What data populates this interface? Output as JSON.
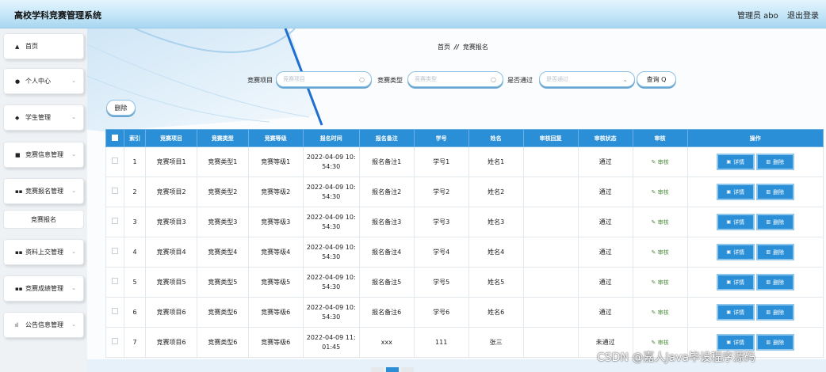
{
  "header": {
    "app_title": "高校学科竞赛管理系统",
    "admin_label": "管理员 abo",
    "logout": "退出登录"
  },
  "sidebar": {
    "items": [
      {
        "icon": "home-icon",
        "glyph": "▲",
        "label": "首页",
        "has_chevron": false
      },
      {
        "icon": "user-icon",
        "glyph": "●",
        "label": "个人中心",
        "has_chevron": true
      },
      {
        "icon": "student-icon",
        "glyph": "◆",
        "label": "学生管理",
        "has_chevron": true
      },
      {
        "icon": "briefcase-icon",
        "glyph": "■",
        "label": "竞赛信息管理",
        "has_chevron": true
      },
      {
        "icon": "grid-icon",
        "glyph": "▪▪",
        "label": "竞赛报名管理",
        "has_chevron": true
      },
      {
        "icon": "grid-icon",
        "glyph": "▪▪",
        "label": "资料上交管理",
        "has_chevron": true
      },
      {
        "icon": "grid-icon",
        "glyph": "▪▪",
        "label": "竞赛成绩管理",
        "has_chevron": true
      },
      {
        "icon": "bar-chart-icon",
        "glyph": "ıl",
        "label": "公告信息管理",
        "has_chevron": true
      }
    ],
    "sub_item": "竞赛报名"
  },
  "breadcrumb": {
    "home": "首页",
    "sep": "//",
    "current": "竞赛报名"
  },
  "search": {
    "project_label": "竞赛项目",
    "project_placeholder": "竞赛项目",
    "type_label": "竞赛类型",
    "type_placeholder": "竞赛类型",
    "pass_label": "是否通过",
    "pass_placeholder": "是否通过",
    "query_button": "查询 Q"
  },
  "toolbar": {
    "delete_batch": "删除"
  },
  "table": {
    "headers": [
      "",
      "索引",
      "竞赛项目",
      "竞赛类型",
      "竞赛等级",
      "报名时间",
      "报名备注",
      "学号",
      "姓名",
      "审核回复",
      "审核状态",
      "审核",
      "操作"
    ],
    "rows": [
      {
        "index": "1",
        "project": "竞赛项目1",
        "type": "竞赛类型1",
        "level": "竞赛等级1",
        "time": "2022-04-09 10:\n54:30",
        "remark": "报名备注1",
        "student_no": "学号1",
        "name": "姓名1",
        "reply": "",
        "status": "通过"
      },
      {
        "index": "2",
        "project": "竞赛项目2",
        "type": "竞赛类型2",
        "level": "竞赛等级2",
        "time": "2022-04-09 10:\n54:30",
        "remark": "报名备注2",
        "student_no": "学号2",
        "name": "姓名2",
        "reply": "",
        "status": "通过"
      },
      {
        "index": "3",
        "project": "竞赛项目3",
        "type": "竞赛类型3",
        "level": "竞赛等级3",
        "time": "2022-04-09 10:\n54:30",
        "remark": "报名备注3",
        "student_no": "学号3",
        "name": "姓名3",
        "reply": "",
        "status": "通过"
      },
      {
        "index": "4",
        "project": "竞赛项目4",
        "type": "竞赛类型4",
        "level": "竞赛等级4",
        "time": "2022-04-09 10:\n54:30",
        "remark": "报名备注4",
        "student_no": "学号4",
        "name": "姓名4",
        "reply": "",
        "status": "通过"
      },
      {
        "index": "5",
        "project": "竞赛项目5",
        "type": "竞赛类型5",
        "level": "竞赛等级5",
        "time": "2022-04-09 10:\n54:30",
        "remark": "报名备注5",
        "student_no": "学号5",
        "name": "姓名5",
        "reply": "",
        "status": "通过"
      },
      {
        "index": "6",
        "project": "竞赛项目6",
        "type": "竞赛类型6",
        "level": "竞赛等级6",
        "time": "2022-04-09 10:\n54:30",
        "remark": "报名备注6",
        "student_no": "学号6",
        "name": "姓名6",
        "reply": "",
        "status": "通过"
      },
      {
        "index": "7",
        "project": "竞赛项目6",
        "type": "竞赛类型6",
        "level": "竞赛等级6",
        "time": "2022-04-09 11:\n01:45",
        "remark": "xxx",
        "student_no": "111",
        "name": "张三",
        "reply": "",
        "status": "未通过"
      }
    ],
    "audit_link": "✎ 审核",
    "detail_button": "详情",
    "delete_button": "删除"
  },
  "watermark": "CSDN @嘉人Java毕设程序源码",
  "colors": {
    "accent": "#2a8fd6",
    "header_top": "#e4f4fd",
    "header_bottom": "#a8d6f0",
    "sidebar_bg": "#eef2f5"
  }
}
